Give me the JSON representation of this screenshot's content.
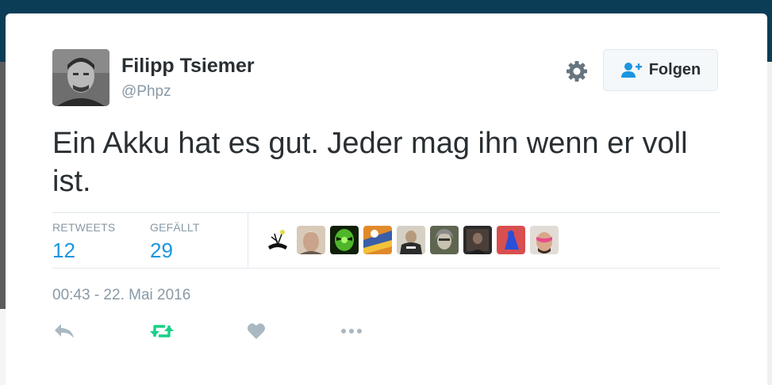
{
  "colors": {
    "page_background": "#0b3d57",
    "name": "#292f33",
    "muted": "#8899a6",
    "link_blue": "#1b95e0",
    "retweet_green": "#19cf86",
    "border": "#e1e8ed"
  },
  "tweet": {
    "author": {
      "display_name": "Filipp Tsiemer",
      "handle": "@Phpz",
      "avatar_icon": "avatar-photo"
    },
    "settings_icon": "gear-icon",
    "follow_button": {
      "label": "Folgen",
      "icon": "user-plus-icon"
    },
    "text": "Ein Akku hat es gut. Jeder mag ihn wenn er voll ist.",
    "stats": {
      "retweets_label": "RETWEETS",
      "retweets_count": "12",
      "likes_label": "GEFÄLLT",
      "likes_count": "29"
    },
    "likers": [
      {
        "icon": "liker-avatar-1",
        "bg": "#ffffff"
      },
      {
        "icon": "liker-avatar-2",
        "bg": "#c9b8a8"
      },
      {
        "icon": "liker-avatar-3",
        "bg": "#1f3d12"
      },
      {
        "icon": "liker-avatar-4",
        "bg": "#d07a25"
      },
      {
        "icon": "liker-avatar-5",
        "bg": "#8a8070"
      },
      {
        "icon": "liker-avatar-6",
        "bg": "#6b6a5a"
      },
      {
        "icon": "liker-avatar-7",
        "bg": "#3a3a3a"
      },
      {
        "icon": "liker-avatar-8",
        "bg": "#d84f4f"
      },
      {
        "icon": "liker-avatar-9",
        "bg": "#d8d2cc"
      }
    ],
    "timestamp": "00:43 - 22. Mai 2016",
    "actions": [
      {
        "name": "reply-icon"
      },
      {
        "name": "retweet-icon"
      },
      {
        "name": "like-icon"
      },
      {
        "name": "more-icon"
      }
    ]
  }
}
